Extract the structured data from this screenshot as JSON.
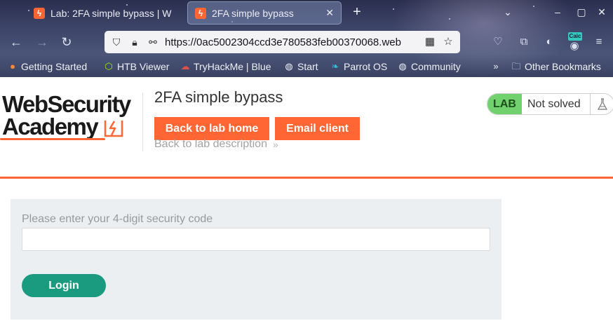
{
  "browser": {
    "tabs": [
      {
        "title": "Lab: 2FA simple bypass | W",
        "active": false
      },
      {
        "title": "2FA simple bypass",
        "active": true
      }
    ],
    "new_tab_icon": "plus-icon",
    "url": "https://0ac5002304ccd3e780583feb00370068.web",
    "extension_badge": "Caic",
    "bookmarks": [
      {
        "label": "Getting Started",
        "icon": "firefox-icon"
      },
      {
        "label": "HTB Viewer",
        "icon": "cube-icon"
      },
      {
        "label": "TryHackMe | Blue",
        "icon": "cloud-icon"
      },
      {
        "label": "Start",
        "icon": "globe-icon"
      },
      {
        "label": "Parrot OS",
        "icon": "parrot-icon"
      },
      {
        "label": "Community",
        "icon": "globe-icon"
      }
    ],
    "other_bookmarks": "Other Bookmarks"
  },
  "header": {
    "logo_line1": "WebSecurity",
    "logo_line2": "Academy",
    "lab_title": "2FA simple bypass",
    "back_home_label": "Back to lab home",
    "email_client_label": "Email client",
    "back_description_label": "Back to lab description",
    "status_pill": "LAB",
    "status_text": "Not solved"
  },
  "form": {
    "label": "Please enter your 4-digit security code",
    "code_value": "",
    "login_label": "Login"
  },
  "colors": {
    "accent": "#ff6633",
    "login": "#1a9a7f",
    "lab_pill": "#70d16d"
  }
}
